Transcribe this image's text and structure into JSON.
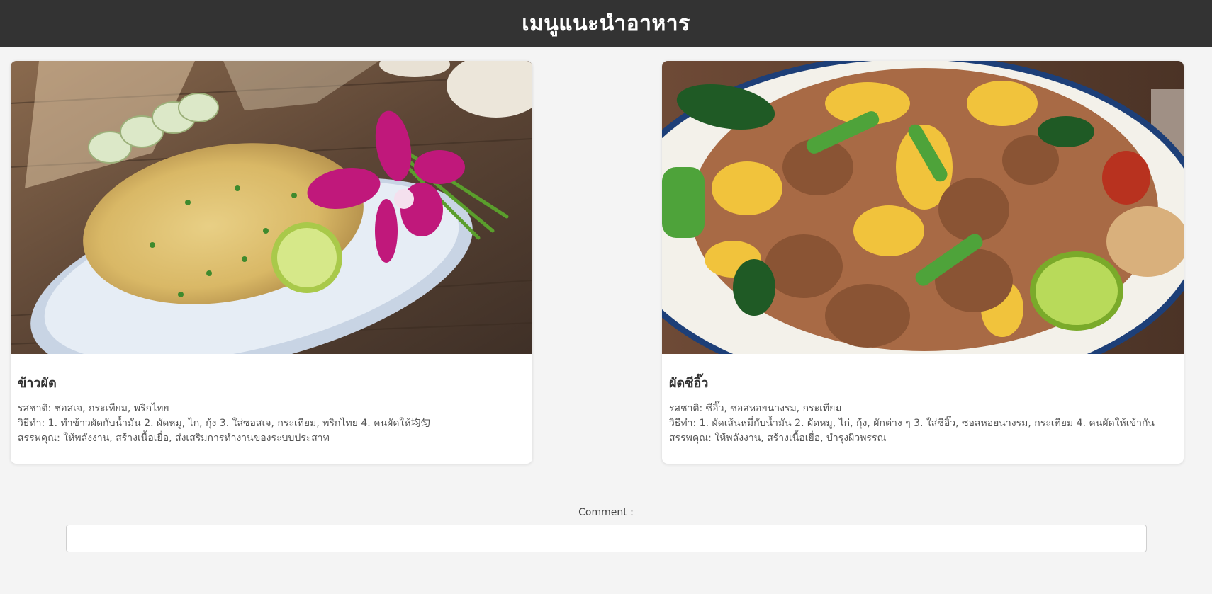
{
  "header": {
    "title": "เมนูแนะนำอาหาร"
  },
  "menus": [
    {
      "name": "ข้าวผัด",
      "flavor": "รสชาติ: ซอสเจ, กระเทียม, พริกไทย",
      "method": "วิธีทำ: 1. ทำข้าวผัดกับน้ำมัน 2. ผัดหมู, ไก่, กุ้ง 3. ใส่ซอสเจ, กระเทียม, พริกไทย 4. คนผัดให้均匀",
      "benefits": "สรรพคุณ: ให้พลังงาน, สร้างเนื้อเยื่อ, ส่งเสริมการทำงานของระบบประสาท",
      "image_icon": "fried-rice-photo"
    },
    {
      "name": "ผัดซีอิ๊ว",
      "flavor": "รสชาติ: ซีอิ๊ว, ซอสหอยนางรม, กระเทียม",
      "method": "วิธีทำ: 1. ผัดเส้นหมี่กับน้ำมัน 2. ผัดหมู, ไก่, กุ้ง, ผักต่าง ๆ 3. ใส่ซีอิ๊ว, ซอสหอยนางรม, กระเทียม 4. คนผัดให้เข้ากัน",
      "benefits": "สรรพคุณ: ให้พลังงาน, สร้างเนื้อเยื่อ, บำรุงผิวพรรณ",
      "image_icon": "pad-see-ew-photo"
    }
  ],
  "comment": {
    "label": "Comment :",
    "value": "",
    "placeholder": ""
  },
  "colors": {
    "header_bg": "#333333",
    "page_bg": "#f4f4f4",
    "card_bg": "#ffffff"
  }
}
